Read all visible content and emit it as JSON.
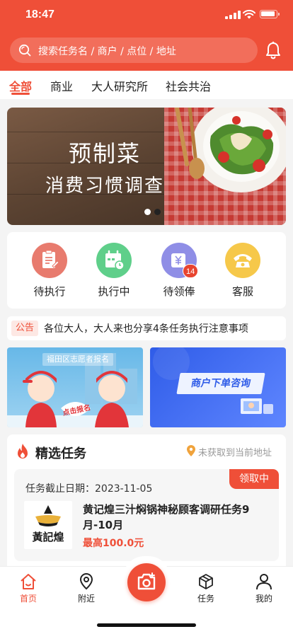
{
  "status_bar": {
    "time": "18:47"
  },
  "search": {
    "placeholder": "搜索任务名 / 商户 / 点位 / 地址"
  },
  "tabs": [
    {
      "label": "全部",
      "active": true
    },
    {
      "label": "商业",
      "active": false
    },
    {
      "label": "大人研究所",
      "active": false
    },
    {
      "label": "社会共治",
      "active": false
    }
  ],
  "banner": {
    "title": "预制菜",
    "subtitle": "消费习惯调查",
    "page_count": 2,
    "current_page": 1
  },
  "quick_actions": [
    {
      "label": "待执行",
      "icon": "clipboard-edit-icon",
      "color": "#e87b6e"
    },
    {
      "label": "执行中",
      "icon": "calendar-clock-icon",
      "color": "#5fcf8a"
    },
    {
      "label": "待领俸",
      "icon": "wallet-yen-icon",
      "color": "#8f8ee6",
      "badge": "14"
    },
    {
      "label": "客服",
      "icon": "phone-icon",
      "color": "#f6c84a"
    }
  ],
  "notice": {
    "tag": "公告",
    "text": "各位大人，大人来也分享4条任务执行注意事项"
  },
  "promos": [
    {
      "title": "福田区志愿者报名",
      "caption": "点击报名"
    },
    {
      "title": "商户下单咨询"
    }
  ],
  "featured": {
    "title": "精选任务",
    "location_text": "未获取到当前地址",
    "task": {
      "status": "领取中",
      "deadline_label": "任务截止日期：",
      "deadline": "2023-11-05",
      "name": "黄记煌三汁焖锅神秘顾客调研任务9月-10月",
      "reward": "最高100.0元",
      "logo_text": "黃記煌"
    }
  },
  "bottom_nav": [
    {
      "label": "首页",
      "icon": "home-icon",
      "active": true
    },
    {
      "label": "附近",
      "icon": "location-pin-icon",
      "active": false
    },
    {
      "label": "任务",
      "icon": "box-icon",
      "active": false
    },
    {
      "label": "我的",
      "icon": "person-icon",
      "active": false
    }
  ],
  "colors": {
    "brand": "#ef4f38",
    "background": "#f4f4f4"
  }
}
